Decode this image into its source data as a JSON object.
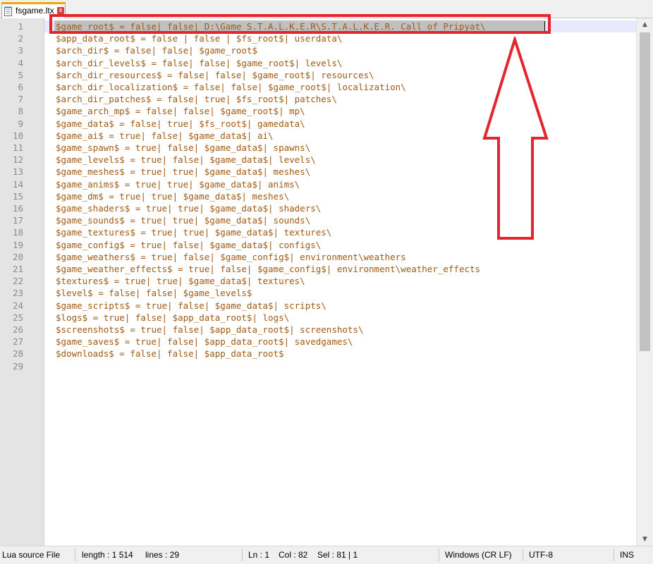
{
  "tab": {
    "label": "fsgame.ltx",
    "close_glyph": "x",
    "icon": "notepad-file-icon"
  },
  "editor": {
    "line_numbers": [
      "1",
      "2",
      "3",
      "4",
      "5",
      "6",
      "7",
      "8",
      "9",
      "10",
      "11",
      "12",
      "13",
      "14",
      "15",
      "16",
      "17",
      "18",
      "19",
      "20",
      "21",
      "22",
      "23",
      "24",
      "25",
      "26",
      "27",
      "28",
      "29"
    ],
    "lines": [
      "$game_root$ = false| false| D:\\Game_S.T.A.L.K.E.R\\S.T.A.L.K.E.R. Call of Pripyat\\",
      "$app_data_root$ = false | false | $fs_root$| userdata\\",
      "$arch_dir$ = false| false| $game_root$",
      "$arch_dir_levels$ = false| false| $game_root$| levels\\",
      "$arch_dir_resources$ = false| false| $game_root$| resources\\",
      "$arch_dir_localization$ = false| false| $game_root$| localization\\",
      "$arch_dir_patches$ = false| true| $fs_root$| patches\\",
      "$game_arch_mp$ = false| false| $game_root$| mp\\",
      "$game_data$ = false| true| $fs_root$| gamedata\\",
      "$game_ai$ = true| false| $game_data$| ai\\",
      "$game_spawn$ = true| false| $game_data$| spawns\\",
      "$game_levels$ = true| false| $game_data$| levels\\",
      "$game_meshes$ = true| true| $game_data$| meshes\\",
      "$game_anims$ = true| true| $game_data$| anims\\",
      "$game_dm$ = true| true| $game_data$| meshes\\",
      "$game_shaders$ = true| true| $game_data$| shaders\\",
      "$game_sounds$ = true| true| $game_data$| sounds\\",
      "$game_textures$ = true| true| $game_data$| textures\\",
      "$game_config$ = true| false| $game_data$| configs\\",
      "$game_weathers$ = true| false| $game_config$| environment\\weathers",
      "$game_weather_effects$ = true| false| $game_config$| environment\\weather_effects",
      "$textures$ = true| true| $game_data$| textures\\",
      "$level$ = false| false| $game_levels$",
      "$game_scripts$ = true| false| $game_data$| scripts\\",
      "$logs$ = true| false| $app_data_root$| logs\\",
      "$screenshots$ = true| false| $app_data_root$| screenshots\\",
      "$game_saves$ = true| false| $app_data_root$| savedgames\\",
      "$downloads$ = false| false| $app_data_root$",
      ""
    ]
  },
  "scrollbar": {
    "up_glyph": "▲",
    "down_glyph": "▼"
  },
  "status": {
    "file_type": "Lua source File",
    "length": "length : 1 514",
    "lines": "lines : 29",
    "ln": "Ln : 1",
    "col": "Col : 82",
    "sel": "Sel : 81 | 1",
    "eol": "Windows (CR LF)",
    "encoding": "UTF-8",
    "mode": "INS"
  },
  "colors": {
    "code_text": "#a05a14",
    "line_numbers": "#8a8a8a",
    "annotation_red": "#e3262e",
    "tab_accent": "#f7a400"
  }
}
